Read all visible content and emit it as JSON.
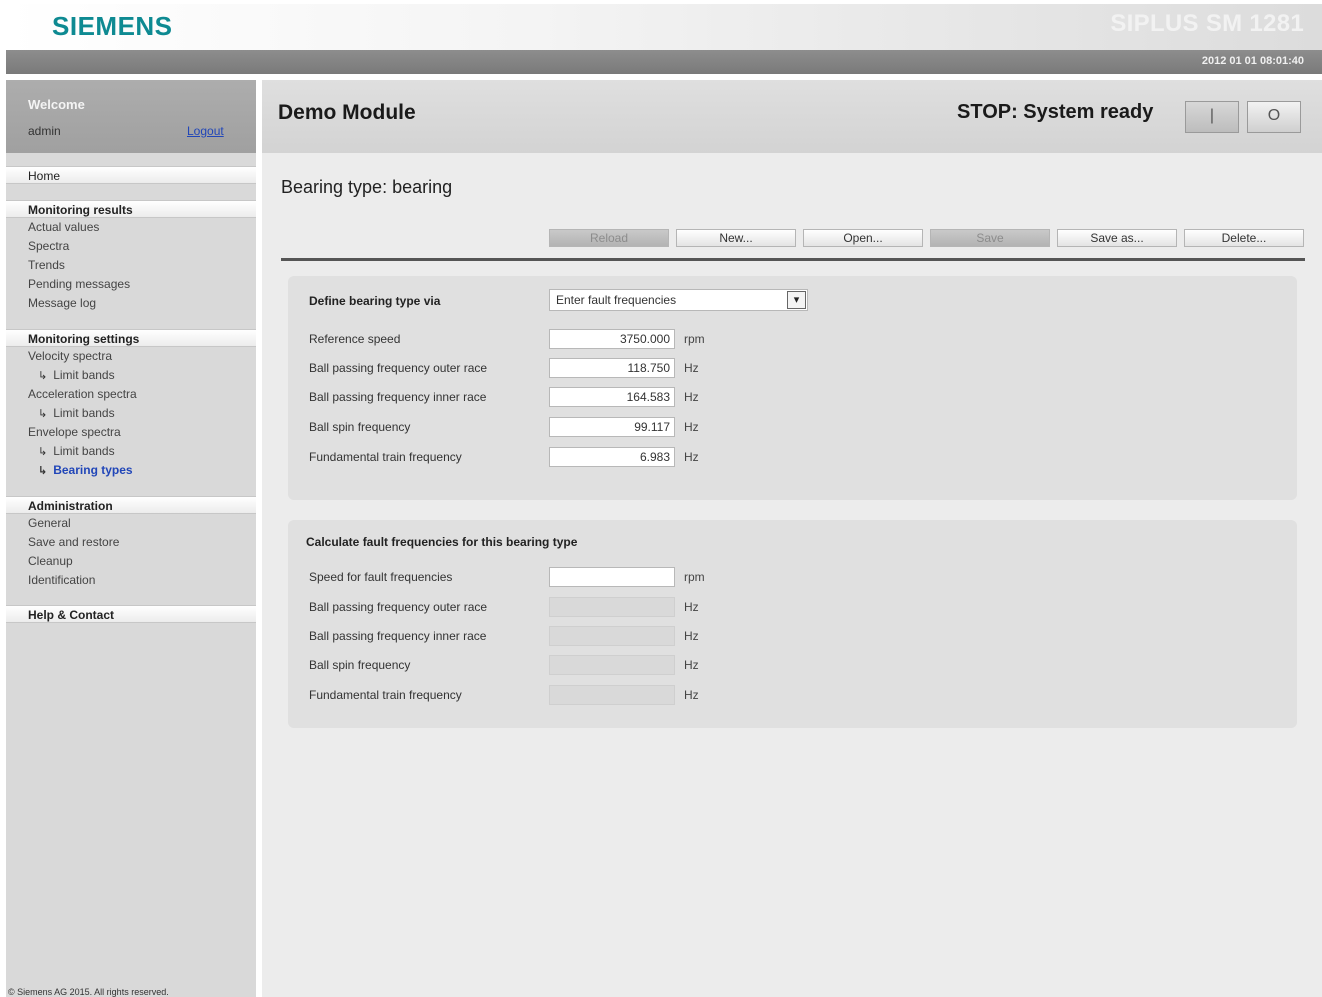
{
  "header": {
    "brand": "SIEMENS",
    "product": "SIPLUS SM 1281",
    "datetime": "2012 01 01 08:01:40"
  },
  "user": {
    "welcome": "Welcome",
    "name": "admin",
    "logout": "Logout"
  },
  "nav": {
    "home": "Home",
    "monitoring_results": {
      "title": "Monitoring results",
      "items": [
        "Actual values",
        "Spectra",
        "Trends",
        "Pending messages",
        "Message log"
      ]
    },
    "monitoring_settings": {
      "title": "Monitoring settings",
      "items": [
        "Velocity spectra",
        "Limit bands",
        "Acceleration spectra",
        "Limit bands",
        "Envelope spectra",
        "Limit bands",
        "Bearing types"
      ]
    },
    "administration": {
      "title": "Administration",
      "items": [
        "General",
        "Save and restore",
        "Cleanup",
        "Identification"
      ]
    },
    "help": "Help & Contact",
    "copyright": "© Siemens AG 2015. All rights reserved."
  },
  "titlebar": {
    "module": "Demo Module",
    "status": "STOP: System ready",
    "run_glyph": "|",
    "stop_glyph": "O"
  },
  "page": {
    "section_title": "Bearing type: bearing"
  },
  "toolbar": {
    "reload": "Reload",
    "new": "New...",
    "open": "Open...",
    "save": "Save",
    "save_as": "Save as...",
    "delete": "Delete..."
  },
  "define": {
    "label": "Define bearing type via",
    "selected": "Enter fault frequencies",
    "rows": [
      {
        "label": "Reference speed",
        "value": "3750.000",
        "unit": "rpm"
      },
      {
        "label": "Ball passing frequency outer race",
        "value": "118.750",
        "unit": "Hz"
      },
      {
        "label": "Ball passing frequency inner race",
        "value": "164.583",
        "unit": "Hz"
      },
      {
        "label": "Ball spin frequency",
        "value": "99.117",
        "unit": "Hz"
      },
      {
        "label": "Fundamental train frequency",
        "value": "6.983",
        "unit": "Hz"
      }
    ]
  },
  "calculate": {
    "title": "Calculate fault frequencies for this bearing type",
    "rows": [
      {
        "label": "Speed for fault frequencies",
        "value": "",
        "unit": "rpm"
      },
      {
        "label": "Ball passing frequency outer race",
        "value": "",
        "unit": "Hz"
      },
      {
        "label": "Ball passing frequency inner race",
        "value": "",
        "unit": "Hz"
      },
      {
        "label": "Ball spin frequency",
        "value": "",
        "unit": "Hz"
      },
      {
        "label": "Fundamental train frequency",
        "value": "",
        "unit": "Hz"
      }
    ]
  },
  "colors": {
    "brand": "#0e8a92",
    "link": "#2146b8"
  }
}
